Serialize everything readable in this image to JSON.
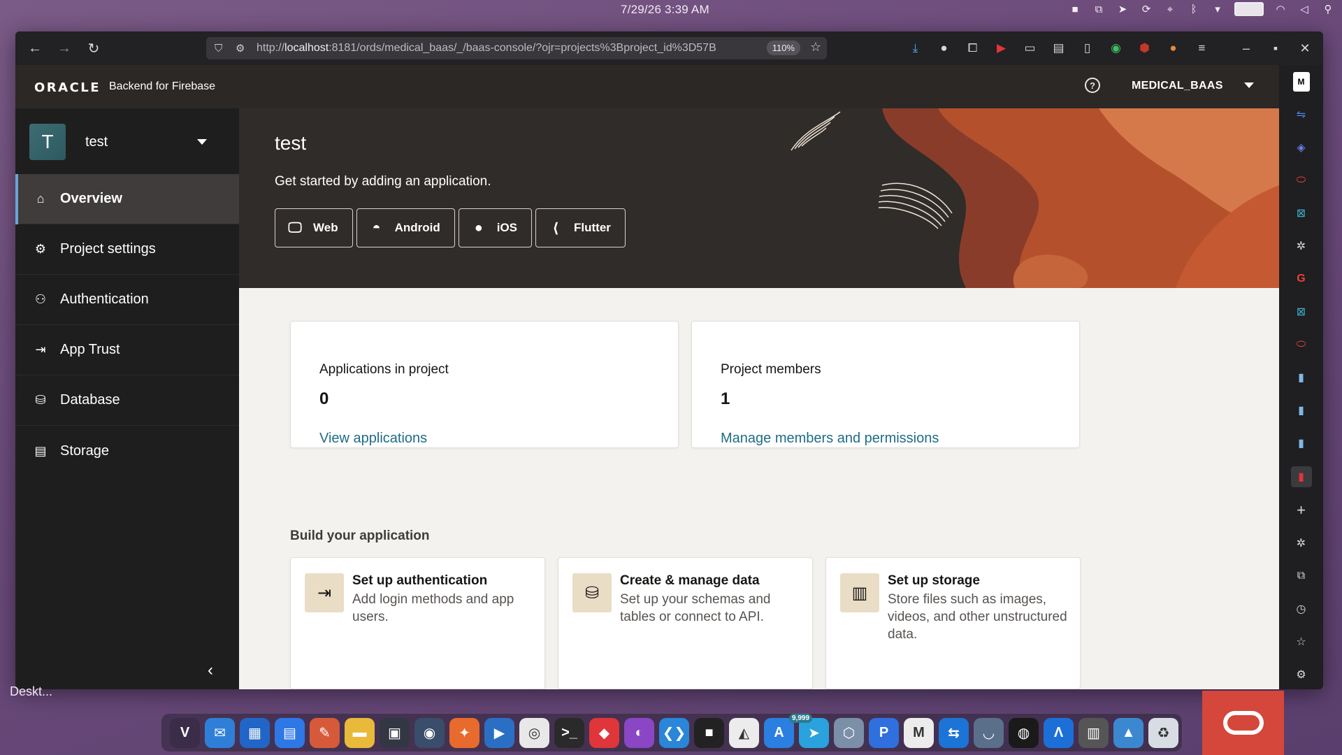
{
  "system_bar": {
    "clock": "7/29/26   3:39 AM",
    "tray_icons": [
      "app-square-icon",
      "screenshot-icon",
      "telegram-icon",
      "sync-icon",
      "location-icon",
      "bluetooth-icon",
      "chevron-down-icon",
      "battery-icon",
      "wifi-icon",
      "volume-icon",
      "search-icon"
    ]
  },
  "browser": {
    "url_prefix": "http://",
    "url_host": "localhost",
    "url_rest": ":8181/ords/medical_baas/_/baas-console/?ojr=projects%3Bproject_id%3D57B",
    "zoom": "110%",
    "extension_icons": [
      "download-icon",
      "account-icon",
      "extensions-icon",
      "youtube-icon",
      "archive-icon",
      "reader-icon",
      "sidebar-icon",
      "eye-icon",
      "ublock-icon",
      "cookie-icon",
      "menu-icon"
    ]
  },
  "app": {
    "logo": "ORACLE",
    "product": "Backend for Firebase",
    "account": "MEDICAL_BAAS",
    "help_glyph": "?"
  },
  "project": {
    "avatar_letter": "T",
    "name": "test"
  },
  "nav": {
    "items": [
      {
        "label": "Overview",
        "icon": "home-icon"
      },
      {
        "label": "Project settings",
        "icon": "gears-icon"
      },
      {
        "label": "Authentication",
        "icon": "user-icon"
      },
      {
        "label": "App Trust",
        "icon": "sign-in-icon"
      },
      {
        "label": "Database",
        "icon": "database-icon"
      },
      {
        "label": "Storage",
        "icon": "archive-box-icon"
      }
    ],
    "collapse_glyph": "‹"
  },
  "hero": {
    "title": "test",
    "subtitle": "Get started by adding an application.",
    "platforms": [
      {
        "label": "Web",
        "icon": "monitor-icon"
      },
      {
        "label": "Android",
        "icon": "android-icon"
      },
      {
        "label": "iOS",
        "icon": "apple-icon"
      },
      {
        "label": "Flutter",
        "icon": "flutter-icon"
      }
    ]
  },
  "stats": [
    {
      "label": "Applications in project",
      "value": "0",
      "link": "View applications"
    },
    {
      "label": "Project members",
      "value": "1",
      "link": "Manage members and permissions"
    }
  ],
  "build": {
    "title": "Build your application",
    "cards": [
      {
        "title": "Set up authentication",
        "desc": "Add login methods and app users.",
        "icon": "sign-in-icon"
      },
      {
        "title": "Create & manage data",
        "desc": "Set up your schemas and tables or connect to API.",
        "icon": "database-icon"
      },
      {
        "title": "Set up storage",
        "desc": "Store files such as images, videos, and other unstructured data.",
        "icon": "storage-icon"
      }
    ]
  },
  "side_panel_icons": [
    "medium-icon",
    "translate-icon",
    "copilot-icon",
    "oracle-icon",
    "excel-icon",
    "openai-icon",
    "google-icon",
    "excel-icon",
    "oracle-icon",
    "doc-icon",
    "doc-icon",
    "doc-icon",
    "bookmark-red-icon",
    "plus-icon",
    "openai-icon",
    "sync-icon",
    "history-icon",
    "star-icon",
    "settings-icon"
  ],
  "desktop": {
    "label": "Deskt..."
  },
  "dock": {
    "apps": [
      {
        "name": "vivaldi",
        "color": "#3b2d4a",
        "glyph": "V"
      },
      {
        "name": "mail",
        "color": "#2f7fd8",
        "glyph": "✉"
      },
      {
        "name": "windows-app",
        "color": "#2166c6",
        "glyph": "▦"
      },
      {
        "name": "calendar",
        "color": "#2e78e6",
        "glyph": "▤"
      },
      {
        "name": "paint",
        "color": "#d65a3a",
        "glyph": "✎"
      },
      {
        "name": "files",
        "color": "#e9b93a",
        "glyph": "▬"
      },
      {
        "name": "terminal-window",
        "color": "#333743",
        "glyph": "▣"
      },
      {
        "name": "lens",
        "color": "#3a4d6a",
        "glyph": "◉"
      },
      {
        "name": "design",
        "color": "#e86a2d",
        "glyph": "✦"
      },
      {
        "name": "vmware",
        "color": "#2b6fc5",
        "glyph": "▶"
      },
      {
        "name": "chrome",
        "color": "#e8e8e8",
        "glyph": "◎"
      },
      {
        "name": "console",
        "color": "#2a2a2a",
        "glyph": ">_"
      },
      {
        "name": "anydesk",
        "color": "#e0353a",
        "glyph": "◆"
      },
      {
        "name": "firefox",
        "color": "#8a46c4",
        "glyph": "◐"
      },
      {
        "name": "vscode",
        "color": "#2a86d8",
        "glyph": "❮❯"
      },
      {
        "name": "box-app",
        "color": "#222",
        "glyph": "■"
      },
      {
        "name": "inkscape",
        "color": "#ececec",
        "glyph": "◭"
      },
      {
        "name": "app-store",
        "color": "#2b7fe0",
        "glyph": "A"
      },
      {
        "name": "telegram",
        "color": "#2aa2dd",
        "glyph": "➤"
      },
      {
        "name": "virtualbox",
        "color": "#7b8fa8",
        "glyph": "⬡"
      },
      {
        "name": "pdf-app",
        "color": "#2f6fde",
        "glyph": "P"
      },
      {
        "name": "gmail",
        "color": "#ececec",
        "glyph": "M"
      },
      {
        "name": "remote",
        "color": "#1b74d6",
        "glyph": "⇆"
      },
      {
        "name": "podcast",
        "color": "#5a6f8a",
        "glyph": "◡"
      },
      {
        "name": "obs",
        "color": "#1a1a1a",
        "glyph": "◍"
      },
      {
        "name": "arch",
        "color": "#1d6fd8",
        "glyph": "Λ"
      },
      {
        "name": "notes",
        "color": "#555",
        "glyph": "▥"
      },
      {
        "name": "photos",
        "color": "#3c88d0",
        "glyph": "▲"
      },
      {
        "name": "trash",
        "color": "#d8dde3",
        "glyph": "♻"
      }
    ],
    "badge": "9,999"
  }
}
